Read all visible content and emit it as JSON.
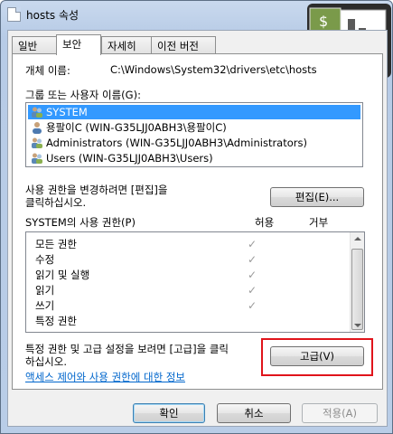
{
  "window": {
    "title": "hosts 속성"
  },
  "tabs": [
    {
      "label": "일반"
    },
    {
      "label": "보안"
    },
    {
      "label": "자세히"
    },
    {
      "label": "이전 버전"
    }
  ],
  "object_name": {
    "label": "개체 이름:",
    "value": "C:\\Windows\\System32\\drivers\\etc\\hosts"
  },
  "group_label": "그룹 또는 사용자 이름(G):",
  "users": [
    {
      "label": "SYSTEM",
      "icon": "user-group-icon",
      "selected": true
    },
    {
      "label": "용팔이C (WIN-G35LJJ0ABH3\\용팔이C)",
      "icon": "user-icon",
      "selected": false
    },
    {
      "label": "Administrators (WIN-G35LJJ0ABH3\\Administrators)",
      "icon": "user-group-icon",
      "selected": false
    },
    {
      "label": "Users (WIN-G35LJJ0ABH3\\Users)",
      "icon": "user-group-icon",
      "selected": false
    }
  ],
  "edit_hint": "사용 권한을 변경하려면 [편집]을\n클릭하십시오.",
  "edit_button": "편집(E)...",
  "permissions": {
    "title": "SYSTEM의 사용 권한(P)",
    "allow_header": "허용",
    "deny_header": "거부",
    "rows": [
      {
        "label": "모든 권한",
        "allow": true
      },
      {
        "label": "수정",
        "allow": true
      },
      {
        "label": "읽기 및 실행",
        "allow": true
      },
      {
        "label": "읽기",
        "allow": true
      },
      {
        "label": "쓰기",
        "allow": true
      },
      {
        "label": "특정 권한",
        "allow": false
      }
    ]
  },
  "advanced_hint": "특정 권한 및 고급 설정을 보려면 [고급]을 클릭\n하십시오.",
  "advanced_button": "고급(V)",
  "help_link": "액세스 제어와 사용 권한에 대한 정보",
  "footer": {
    "ok": "확인",
    "cancel": "취소",
    "apply": "적용(A)"
  },
  "colors": {
    "selection": "#3399ff",
    "highlight": "#e0141b",
    "link": "#0066cc"
  }
}
